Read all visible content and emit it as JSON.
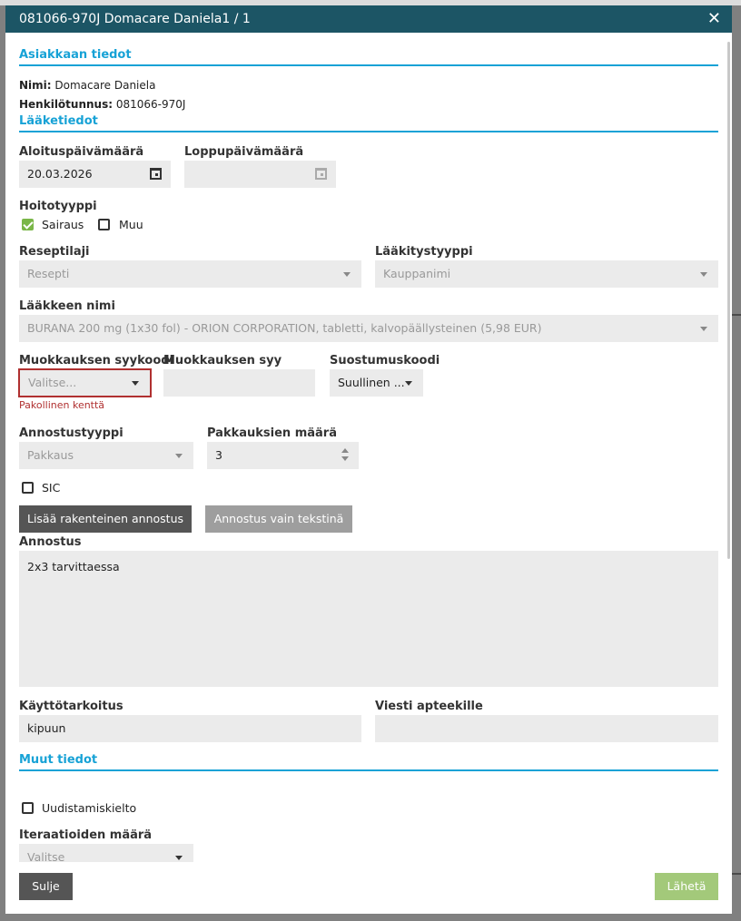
{
  "window": {
    "title": "081066-970J Domacare Daniela1 / 1",
    "close_glyph": "✕"
  },
  "customer": {
    "section_title": "Asiakkaan tiedot",
    "name_label": "Nimi:",
    "name_value": "Domacare Daniela",
    "ssn_label": "Henkilötunnus:",
    "ssn_value": "081066-970J"
  },
  "medication": {
    "section_title": "Lääketiedot",
    "start_date_label": "Aloituspäivämäärä",
    "start_date_value": "20.03.2026",
    "end_date_label": "Loppupäivämäärä",
    "end_date_value": "",
    "care_type_label": "Hoitotyyppi",
    "care_types": [
      {
        "label": "Sairaus",
        "checked": true
      },
      {
        "label": "Muu",
        "checked": false
      }
    ],
    "prescription_type_label": "Reseptilaji",
    "prescription_type_value": "Resepti",
    "medication_type_label": "Lääkitystyyppi",
    "medication_type_value": "Kauppanimi",
    "drug_name_label": "Lääkkeen nimi",
    "drug_name_value": "BURANA 200 mg (1x30 fol) - ORION CORPORATION, tabletti, kalvopäällysteinen (5,98 EUR)",
    "edit_reason_code_label": "Muokkauksen syykoodi",
    "edit_reason_code_placeholder": "Valitse...",
    "edit_reason_code_error": "Pakollinen kenttä",
    "edit_reason_label": "Muokkauksen syy",
    "edit_reason_value": "",
    "consent_code_label": "Suostumuskoodi",
    "consent_code_value": "Suullinen ...",
    "dosage_type_label": "Annostustyyppi",
    "dosage_type_value": "Pakkaus",
    "package_count_label": "Pakkauksien määrä",
    "package_count_value": "3",
    "sic_label": "SIC",
    "sic_checked": false,
    "add_structured_button": "Lisää rakenteinen annostus",
    "text_only_button": "Annostus vain tekstinä",
    "dosage_label": "Annostus",
    "dosage_value": "2x3 tarvittaessa",
    "purpose_label": "Käyttötarkoitus",
    "purpose_value": "kipuun",
    "pharmacy_message_label": "Viesti apteekille",
    "pharmacy_message_value": ""
  },
  "other": {
    "section_title": "Muut tiedot",
    "renewal_ban_label": "Uudistamiskielto",
    "renewal_ban_checked": false,
    "iterations_label": "Iteraatioiden määrä",
    "iterations_placeholder": "Valitse"
  },
  "footer": {
    "close_button": "Sulje",
    "send_button": "Lähetä"
  },
  "colors": {
    "header": "#1c5565",
    "accent": "#17a2d6",
    "error": "#b03030",
    "send": "#a3c97a"
  }
}
